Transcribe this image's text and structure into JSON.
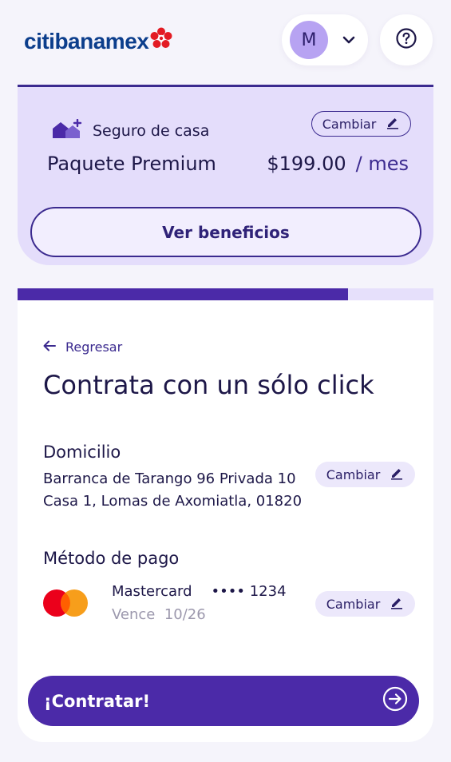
{
  "header": {
    "logo_text": "citibanamex",
    "user_initial": "M"
  },
  "plan": {
    "category": "Seguro de casa",
    "change_label": "Cambiar",
    "name": "Paquete Premium",
    "price": "$199.00",
    "period": "/ mes",
    "benefits_label": "Ver beneficios"
  },
  "progress": {
    "fraction": 0.795
  },
  "main": {
    "back_label": "Regresar",
    "title": "Contrata con un sólo click",
    "address": {
      "heading": "Domicilio",
      "line1": "Barranca de Tarango 96 Privada 10",
      "line2": "Casa 1, Lomas de Axomiatla, 01820",
      "change_label": "Cambiar"
    },
    "payment": {
      "heading": "Método de pago",
      "brand": "Mastercard",
      "masked_number": "•••• 1234",
      "expiry": "Vence  10/26",
      "change_label": "Cambiar"
    },
    "cta_label": "¡Contratar!"
  },
  "colors": {
    "accent": "#4b2aa8",
    "brand_blue": "#0c3e8c",
    "brand_red": "#e31b23",
    "plan_bg": "#e4ddfb"
  }
}
